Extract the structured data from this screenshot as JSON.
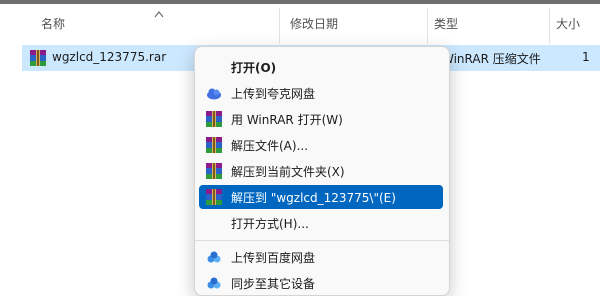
{
  "header": {
    "name": "名称",
    "modified": "修改日期",
    "type": "类型",
    "size": "大小"
  },
  "file": {
    "name": "wgzlcd_123775.rar",
    "type": "WinRAR 压缩文件",
    "size": "1"
  },
  "menu": {
    "items": [
      {
        "label": "打开(O)",
        "icon": "none",
        "bold": true
      },
      {
        "label": "上传到夸克网盘",
        "icon": "quark-cloud-icon"
      },
      {
        "label": "用 WinRAR 打开(W)",
        "icon": "winrar-icon"
      },
      {
        "label": "解压文件(A)...",
        "icon": "winrar-icon"
      },
      {
        "label": "解压到当前文件夹(X)",
        "icon": "winrar-icon"
      },
      {
        "label": "解压到 \"wgzlcd_123775\\\"(E)",
        "icon": "winrar-icon",
        "highlighted": true
      },
      {
        "label": "打开方式(H)...",
        "icon": "none"
      },
      {
        "label": "上传到百度网盘",
        "icon": "baidu-cloud-icon"
      },
      {
        "label": "同步至其它设备",
        "icon": "baidu-sync-icon"
      }
    ]
  },
  "colors": {
    "selection": "#cce8ff",
    "highlight": "#0067c0",
    "menu_bg": "#f9f9f9"
  }
}
